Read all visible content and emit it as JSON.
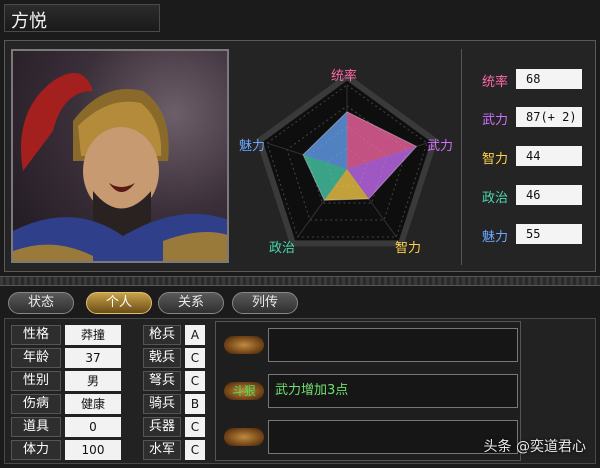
{
  "window": {
    "title": "方悦"
  },
  "radar": {
    "labels": {
      "top": "统率",
      "right": "武力",
      "bottom_right": "智力",
      "bottom_left": "政治",
      "left": "魅力"
    },
    "values": {
      "统率": 68,
      "武力": 87,
      "智力": 44,
      "政治": 46,
      "魅力": 55
    },
    "max": 100
  },
  "stats": [
    {
      "label": "统率",
      "value": "68",
      "color": "#ff6aa8"
    },
    {
      "label": "武力",
      "value": "87(+ 2)",
      "color": "#d070ff"
    },
    {
      "label": "智力",
      "value": "44",
      "color": "#ffd24a"
    },
    {
      "label": "政治",
      "value": "46",
      "color": "#4ad6b0"
    },
    {
      "label": "魅力",
      "value": "55",
      "color": "#6aa8ff"
    }
  ],
  "tabs": [
    {
      "label": "状态",
      "active": false
    },
    {
      "label": "个人",
      "active": true
    },
    {
      "label": "关系",
      "active": false
    },
    {
      "label": "列传",
      "active": false
    }
  ],
  "attributes": [
    {
      "key": "性格",
      "value": "莽撞"
    },
    {
      "key": "年龄",
      "value": "37"
    },
    {
      "key": "性别",
      "value": "男"
    },
    {
      "key": "伤病",
      "value": "健康"
    },
    {
      "key": "道具",
      "value": "0"
    },
    {
      "key": "体力",
      "value": "100"
    }
  ],
  "skills": [
    {
      "key": "枪兵",
      "value": "A"
    },
    {
      "key": "戟兵",
      "value": "C"
    },
    {
      "key": "弩兵",
      "value": "C"
    },
    {
      "key": "骑兵",
      "value": "B"
    },
    {
      "key": "兵器",
      "value": "C"
    },
    {
      "key": "水军",
      "value": "C"
    }
  ],
  "traits": [
    {
      "name": "",
      "desc": ""
    },
    {
      "name": "斗狠",
      "desc": "武力增加3点"
    },
    {
      "name": "",
      "desc": ""
    }
  ],
  "watermark": "头条 @奕道君心"
}
